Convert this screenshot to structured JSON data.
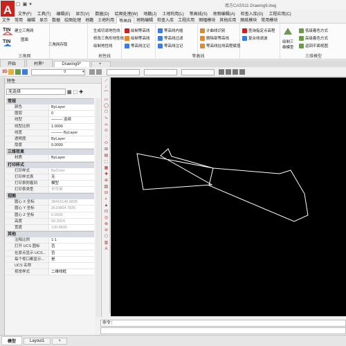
{
  "titlebar": {
    "title": "南方CASS11    Drawing9.dwg"
  },
  "menu": [
    "文件(F)",
    "工具(T)",
    "编辑(E)",
    "显示(V)",
    "数据(D)",
    "绘图处理(W)",
    "地籍(J)",
    "土地利用(L)",
    "等高线(S)",
    "地物编辑(A)",
    "检查入库(G)",
    "工程应用(C)"
  ],
  "ribbon_tabs": [
    "文件",
    "常用",
    "编辑",
    "显示",
    "数据",
    "绘图处理",
    "地籍",
    "土地利用",
    "等高线",
    "地物编辑",
    "检查入库",
    "工程应用",
    "图幅模块",
    "其他应用",
    "图纸模块",
    "常用模块"
  ],
  "ribbon_active_tab": "等高线",
  "ribbon": {
    "p1": {
      "b1": "建立三角网",
      "b2": "图面",
      "b3": "三角网存取",
      "b4": "三角网",
      "title": "三角网"
    },
    "p2": {
      "b1": "生成切滤地性线",
      "b2": "修改三角形地性线",
      "b3": "绘制地性线",
      "title": "地性线"
    },
    "p3": {
      "b1": "绘制等高线",
      "b2": "绘制等高线",
      "b3": "等高线注记"
    },
    "p4": {
      "b1": "等高线内插",
      "b2": "等高线过滤",
      "b3": "等高线注记"
    },
    "p5": {
      "b1": "计曲线识别",
      "b2": "删除部等高线",
      "b3": "等高线拉线高程赋值",
      "title": "等高线"
    },
    "p6": {
      "b1": "查询指定点高程",
      "b2": "复合线滤波"
    },
    "p7": {
      "b1": "绘制三维模型",
      "b2": "低级着色方式",
      "b3": "高级着色方式",
      "b4": "返回平面视图",
      "title": "三维模型"
    }
  },
  "doc_tabs": [
    "开始",
    "村界*",
    "Drawing9*"
  ],
  "layer_bar": {
    "layer_value": "0"
  },
  "properties": {
    "title": "特性",
    "selection": "无选择",
    "sections": [
      {
        "title": "常规",
        "rows": [
          {
            "k": "颜色",
            "v": "ByLayer",
            "gray": false
          },
          {
            "k": "图层",
            "v": "0",
            "gray": false
          },
          {
            "k": "线型",
            "v": "——— 连续",
            "gray": false
          },
          {
            "k": "线型比例",
            "v": "1.0000",
            "gray": false
          },
          {
            "k": "线宽",
            "v": "——— ByLayer",
            "gray": false
          },
          {
            "k": "透明度",
            "v": "ByLayer",
            "gray": false
          },
          {
            "k": "厚度",
            "v": "0.0000",
            "gray": false
          }
        ]
      },
      {
        "title": "三维效果",
        "rows": [
          {
            "k": "材质",
            "v": "ByLayer",
            "gray": false
          }
        ]
      },
      {
        "title": "打印样式",
        "rows": [
          {
            "k": "打印样式",
            "v": "ByColor",
            "gray": true
          },
          {
            "k": "打印样式表",
            "v": "无",
            "gray": false
          },
          {
            "k": "打印表附着到",
            "v": "模型",
            "gray": false
          },
          {
            "k": "打印表类型",
            "v": "不可用",
            "gray": true
          }
        ]
      },
      {
        "title": "视图",
        "rows": [
          {
            "k": "圆心 X 坐标",
            "v": "38416146.6835",
            "gray": true
          },
          {
            "k": "圆心 Y 坐标",
            "v": "2610804.7835",
            "gray": true
          },
          {
            "k": "圆心 Z 坐标",
            "v": "0.0000",
            "gray": true
          },
          {
            "k": "高度",
            "v": "69.3024",
            "gray": true
          },
          {
            "k": "宽度",
            "v": "130.8835",
            "gray": true
          }
        ]
      },
      {
        "title": "其他",
        "rows": [
          {
            "k": "注释比例",
            "v": "1:1",
            "gray": false
          },
          {
            "k": "打开 UCS 图标",
            "v": "否",
            "gray": false
          },
          {
            "k": "在原点显示 UCS...",
            "v": "否",
            "gray": false
          },
          {
            "k": "每个视口都显示...",
            "v": "是",
            "gray": false
          },
          {
            "k": "UCS 名称",
            "v": "",
            "gray": false
          },
          {
            "k": "视觉样式",
            "v": "二维线框",
            "gray": false
          }
        ]
      }
    ]
  },
  "command": {
    "prompt": "命令："
  },
  "layout_tabs": [
    "模型",
    "Layout1"
  ],
  "colors": {
    "app_red": "#c8231e",
    "canvas_bg": "#000000",
    "geometry": "#ffffff"
  }
}
